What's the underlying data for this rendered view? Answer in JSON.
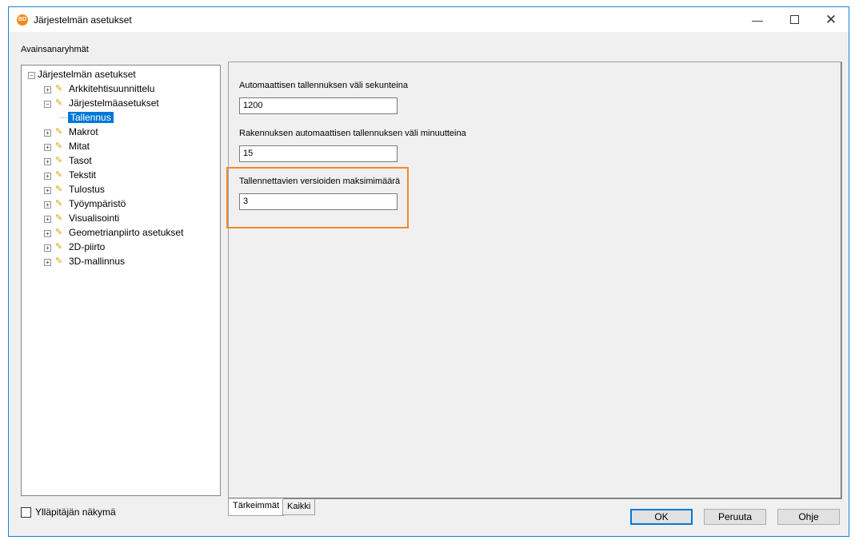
{
  "window": {
    "title": "Järjestelmän asetukset",
    "icon_text": "BD",
    "controls": {
      "minimize": "—",
      "close": "✕"
    }
  },
  "sidebar": {
    "group_label": "Avainsanaryhmät",
    "tree": {
      "root": "Järjestelmän asetukset",
      "items": [
        {
          "label": "Arkkitehtisuunnittelu"
        },
        {
          "label": "Järjestelmäasetukset",
          "expanded": true,
          "children": [
            {
              "label": "Tallennus",
              "selected": true
            }
          ]
        },
        {
          "label": "Makrot"
        },
        {
          "label": "Mitat"
        },
        {
          "label": "Tasot"
        },
        {
          "label": "Tekstit"
        },
        {
          "label": "Tulostus"
        },
        {
          "label": "Työympäristö"
        },
        {
          "label": "Visualisointi"
        },
        {
          "label": "Geometrianpiirto asetukset"
        },
        {
          "label": "2D-piirto"
        },
        {
          "label": "3D-mallinnus"
        }
      ]
    },
    "admin_view_label": "Ylläpitäjän näkymä",
    "admin_view_checked": false
  },
  "settings": {
    "fields": [
      {
        "label": "Automaattisen tallennuksen väli sekunteina",
        "value": "1200"
      },
      {
        "label": "Rakennuksen automaattisen tallennuksen väli minuutteina",
        "value": "15"
      },
      {
        "label": "Tallennettavien versioiden maksimimäärä",
        "value": "3",
        "highlighted": true
      }
    ]
  },
  "tabs": [
    {
      "label": "Tärkeimmät",
      "active": true
    },
    {
      "label": "Kaikki",
      "active": false
    }
  ],
  "buttons": {
    "ok": "OK",
    "cancel": "Peruuta",
    "help": "Ohje"
  },
  "colors": {
    "selection": "#0078d7",
    "highlight_border": "#f08a2c",
    "default_button_border": "#0078d7"
  }
}
